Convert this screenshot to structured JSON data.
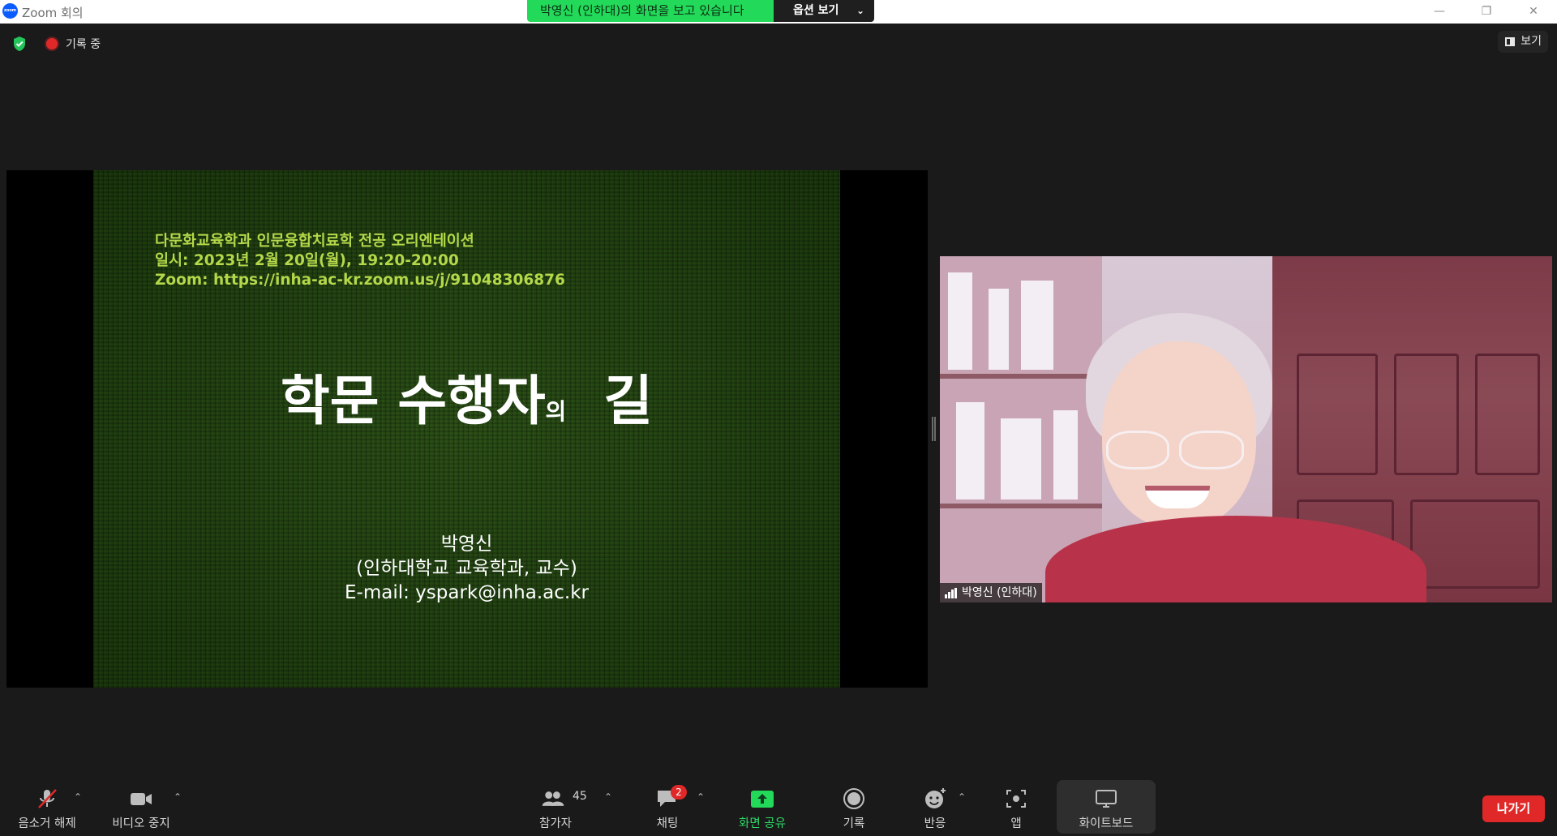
{
  "window": {
    "title": "Zoom 회의",
    "logo_text": "zoom",
    "controls": {
      "minimize": "—",
      "restore": "❐",
      "close": "✕"
    }
  },
  "share_banner": {
    "text": "박영신 (인하대)의 화면을 보고 있습니다",
    "options_label": "옵션 보기",
    "options_chevron": "⌄"
  },
  "status": {
    "recording_label": "기록 중",
    "view_label": "보기"
  },
  "slide": {
    "info_lines": [
      "다문화교육학과 인문융합치료학 전공 오리엔테이션",
      "일시: 2023년 2월 20일(월), 19:20-20:00",
      "Zoom: https://inha-ac-kr.zoom.us/j/91048306876"
    ],
    "title_main": "학문 수행자",
    "title_particle": "의",
    "title_end": "길",
    "author_lines": [
      "박영신",
      "(인하대학교 교육학과, 교수)",
      "E-mail: yspark@inha.ac.kr"
    ]
  },
  "video": {
    "participant_name": "박영신 (인하대)"
  },
  "toolbar": {
    "mute_label": "음소거 해제",
    "video_label": "비디오 중지",
    "participants_label": "참가자",
    "participants_count": "45",
    "chat_label": "채팅",
    "chat_badge": "2",
    "share_label": "화면 공유",
    "record_label": "기록",
    "reactions_label": "반응",
    "apps_label": "앱",
    "whiteboard_label": "화이트보드",
    "leave_label": "나가기",
    "caret": "⌃"
  },
  "colors": {
    "share_green": "#23d959",
    "leave_red": "#e02828",
    "slide_text_green": "#b4d84a",
    "zoom_blue": "#0b5cff"
  }
}
